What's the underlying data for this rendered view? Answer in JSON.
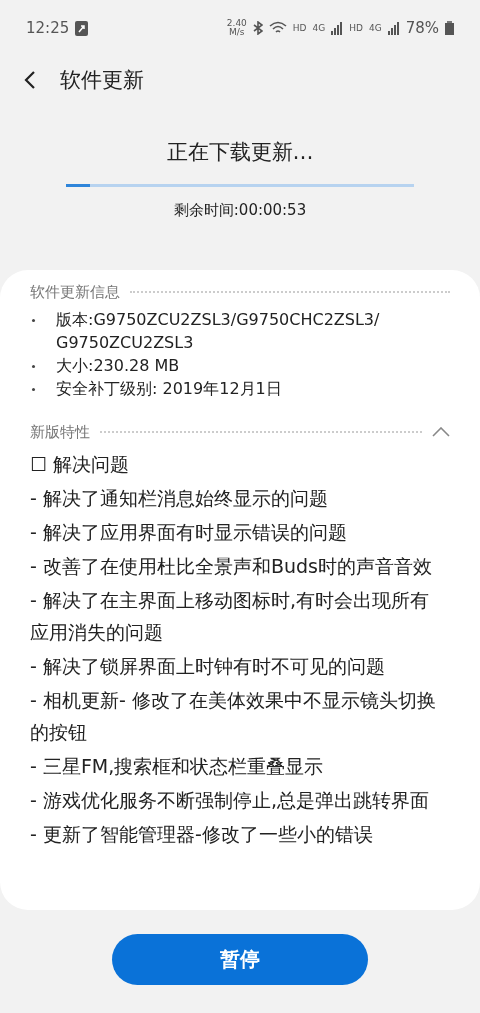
{
  "status_bar": {
    "time": "12:25",
    "speed": "2.40\nM/s",
    "network_labels": [
      "HD",
      "4G",
      "HD",
      "4G"
    ],
    "battery": "78%"
  },
  "header": {
    "title": "软件更新"
  },
  "download": {
    "title": "正在下载更新…",
    "level": 0.07,
    "remaining": "剩余时间:00:00:53"
  },
  "info": {
    "title": "软件更新信息",
    "items": [
      "版本:G9750ZCU2ZSL3/G9750CHC2ZSL3/\nG9750ZCU2ZSL3",
      "大小:230.28 MB",
      "安全补丁级别: 2019年12月1日"
    ]
  },
  "features": {
    "title": "新版特性",
    "expanded": true,
    "items": [
      "☐ 解决问题",
      "- 解决了通知栏消息始终显示的问题",
      "- 解决了应用界面有时显示错误的问题",
      "- 改善了在使用杜比全景声和Buds时的声音音效",
      "- 解决了在主界面上移动图标时,有时会出现所有应用消失的问题",
      "- 解决了锁屏界面上时钟有时不可见的问题",
      "- 相机更新- 修改了在美体效果中不显示镜头切换的按钮",
      "- 三星FM,搜索框和状态栏重叠显示",
      "- 游戏优化服务不断强制停止,总是弹出跳转界面",
      "- 更新了智能管理器-修改了一些小的错误"
    ]
  },
  "button": {
    "label": "暂停"
  }
}
